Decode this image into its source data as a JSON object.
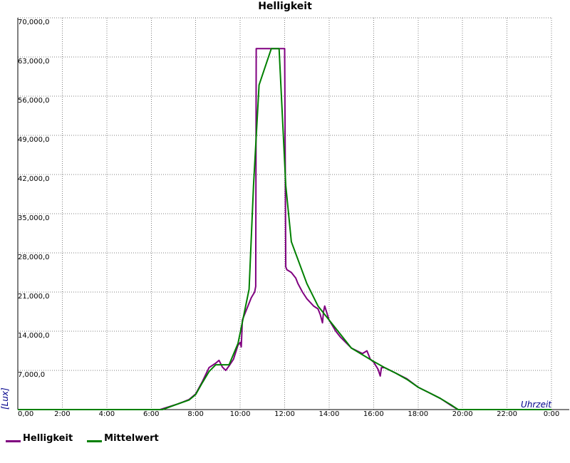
{
  "colors": {
    "helligkeit": "#800080",
    "mittelwert": "#008000",
    "axis_label": "#00008b",
    "grid": "#808080"
  },
  "legend": {
    "items": [
      {
        "label": "Helligkeit",
        "color": "#800080"
      },
      {
        "label": "Mittelwert",
        "color": "#008000"
      }
    ]
  },
  "chart_data": {
    "type": "line",
    "title": "Helligkeit",
    "xlabel": "Uhrzeit",
    "ylabel": "[Lux]",
    "xlim": [
      0,
      24
    ],
    "ylim": [
      0,
      70000
    ],
    "grid": true,
    "legend_position": "bottom-left",
    "x_ticks": [
      "0,00",
      "2:00",
      "4:00",
      "6:00",
      "8:00",
      "10:00",
      "12:00",
      "14:00",
      "16:00",
      "18:00",
      "20:00",
      "22:00",
      "0:00"
    ],
    "y_ticks": [
      "7,000,0",
      "14,000,0",
      "21,000,0",
      "28,000,0",
      "35,000,0",
      "42,000,0",
      "49,000,0",
      "56,000,0",
      "63,000,0",
      "70,000,0"
    ],
    "y_tick_values": [
      7000,
      14000,
      21000,
      28000,
      35000,
      42000,
      49000,
      56000,
      63000,
      70000
    ],
    "series": [
      {
        "name": "Helligkeit",
        "x": [
          0,
          6.4,
          7.2,
          7.7,
          8.0,
          8.3,
          8.6,
          8.9,
          9.05,
          9.2,
          9.35,
          9.5,
          9.7,
          9.9,
          10.0,
          10.05,
          10.1,
          10.2,
          10.35,
          10.5,
          10.65,
          10.7,
          10.72,
          11.5,
          12.0,
          12.05,
          12.1,
          12.3,
          12.5,
          12.6,
          12.8,
          13.0,
          13.3,
          13.5,
          13.6,
          13.7,
          13.75,
          13.8,
          14.0,
          14.3,
          14.5,
          15.0,
          15.5,
          15.7,
          15.85,
          16.0,
          16.2,
          16.3,
          16.35,
          16.5,
          17.0,
          17.5,
          18.0,
          18.5,
          19.0,
          19.5,
          19.8,
          24
        ],
        "y": [
          0,
          0,
          1000,
          1800,
          2800,
          5000,
          7500,
          8300,
          8800,
          7600,
          7000,
          7800,
          9000,
          11500,
          12000,
          11200,
          16000,
          17000,
          18500,
          20000,
          21000,
          22000,
          64500,
          64500,
          64500,
          25500,
          25000,
          24500,
          23500,
          22500,
          21000,
          19800,
          18500,
          18000,
          17000,
          15500,
          17500,
          18500,
          16000,
          14000,
          13000,
          11000,
          10000,
          10500,
          9000,
          8500,
          7200,
          6000,
          7500,
          7500,
          6500,
          5500,
          4000,
          3000,
          2000,
          700,
          0,
          0
        ]
      },
      {
        "name": "Mittelwert",
        "x": [
          0,
          6.5,
          7.2,
          7.7,
          8.0,
          8.3,
          8.6,
          8.9,
          9.5,
          9.9,
          10.4,
          10.6,
          10.85,
          11.4,
          11.75,
          12.05,
          12.3,
          13.0,
          13.5,
          14.0,
          14.5,
          15.0,
          15.5,
          16.0,
          16.5,
          17.0,
          17.5,
          18.0,
          18.5,
          19.0,
          19.5,
          19.8,
          24
        ],
        "y": [
          0,
          0,
          1000,
          1700,
          2700,
          4800,
          6800,
          8000,
          8000,
          11800,
          21500,
          40000,
          58000,
          64500,
          64500,
          40000,
          30000,
          22500,
          18500,
          16000,
          13500,
          11000,
          9800,
          8600,
          7500,
          6500,
          5400,
          4000,
          3000,
          2000,
          800,
          0,
          0
        ]
      }
    ]
  }
}
